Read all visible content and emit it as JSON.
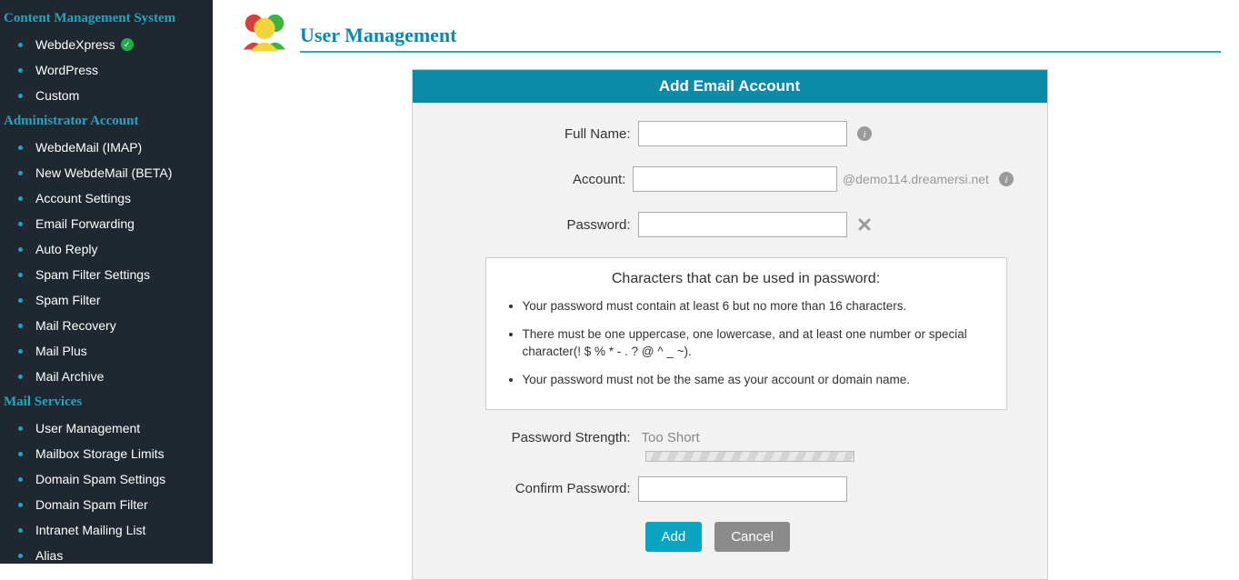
{
  "sidebar": {
    "sections": [
      {
        "title": "Content Management System",
        "items": [
          {
            "label": "WebdeXpress",
            "checked": true
          },
          {
            "label": "WordPress"
          },
          {
            "label": "Custom"
          }
        ]
      },
      {
        "title": "Administrator Account",
        "items": [
          {
            "label": "WebdeMail (IMAP)"
          },
          {
            "label": "New WebdeMail (BETA)"
          },
          {
            "label": "Account Settings"
          },
          {
            "label": "Email Forwarding"
          },
          {
            "label": "Auto Reply"
          },
          {
            "label": "Spam Filter Settings"
          },
          {
            "label": "Spam Filter"
          },
          {
            "label": "Mail Recovery"
          },
          {
            "label": "Mail Plus"
          },
          {
            "label": "Mail Archive"
          }
        ]
      },
      {
        "title": "Mail Services",
        "items": [
          {
            "label": "User Management"
          },
          {
            "label": "Mailbox Storage Limits"
          },
          {
            "label": "Domain Spam Settings"
          },
          {
            "label": "Domain Spam Filter"
          },
          {
            "label": "Intranet Mailing List"
          },
          {
            "label": "Alias"
          }
        ]
      }
    ]
  },
  "page": {
    "title": "User Management"
  },
  "panel": {
    "header": "Add Email Account",
    "fields": {
      "full_name_label": "Full Name:",
      "account_label": "Account:",
      "account_domain": "@demo114.dreamersi.net",
      "password_label": "Password:",
      "confirm_label": "Confirm Password:"
    },
    "rules": {
      "title": "Characters that can be used in password:",
      "items": [
        "Your password must contain at least 6 but no more than 16 characters.",
        "There must be one uppercase, one lowercase, and at least one number or special character(! $ % * - . ? @ ^ _ ~).",
        "Your password must not be the same as your account or domain name."
      ]
    },
    "strength": {
      "label": "Password Strength:",
      "value": "Too Short"
    },
    "buttons": {
      "add": "Add",
      "cancel": "Cancel"
    }
  }
}
